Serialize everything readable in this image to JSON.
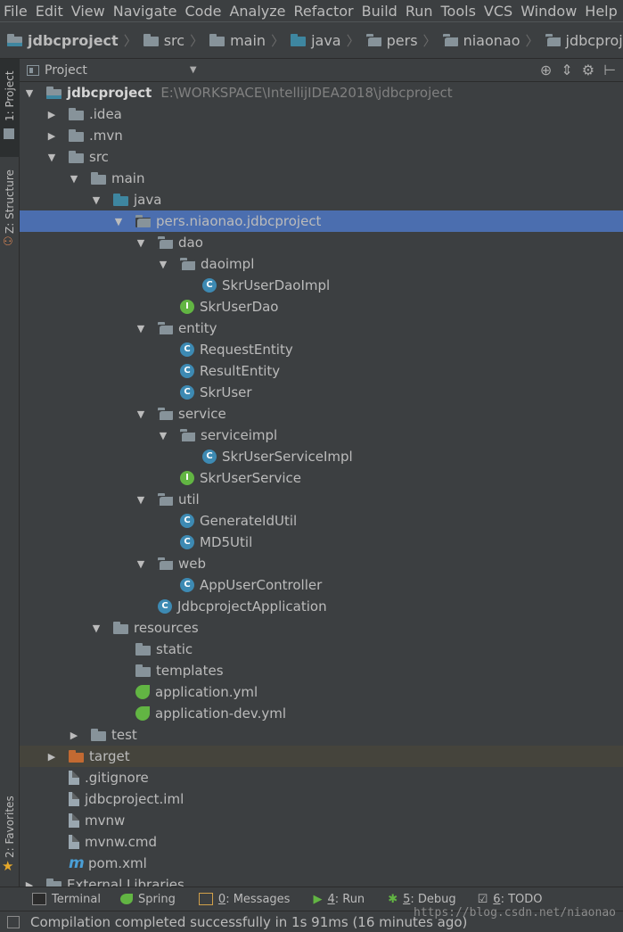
{
  "menubar": [
    "File",
    "Edit",
    "View",
    "Navigate",
    "Code",
    "Analyze",
    "Refactor",
    "Build",
    "Run",
    "Tools",
    "VCS",
    "Window",
    "Help"
  ],
  "breadcrumbs": [
    "jdbcproject",
    "src",
    "main",
    "java",
    "pers",
    "niaonao",
    "jdbcproject"
  ],
  "left_tabs": {
    "project": "1: Project",
    "structure": "Z: Structure",
    "favorites": "2: Favorites"
  },
  "panel": {
    "title": "Project"
  },
  "tree": [
    {
      "label": "jdbcproject",
      "path": "E:\\WORKSPACE\\IntellijIDEA2018\\jdbcproject"
    },
    {
      "label": ".idea"
    },
    {
      "label": ".mvn"
    },
    {
      "label": "src"
    },
    {
      "label": "main"
    },
    {
      "label": "java"
    },
    {
      "label": "pers.niaonao.jdbcproject"
    },
    {
      "label": "dao"
    },
    {
      "label": "daoimpl"
    },
    {
      "label": "SkrUserDaoImpl"
    },
    {
      "label": "SkrUserDao"
    },
    {
      "label": "entity"
    },
    {
      "label": "RequestEntity"
    },
    {
      "label": "ResultEntity"
    },
    {
      "label": "SkrUser"
    },
    {
      "label": "service"
    },
    {
      "label": "serviceimpl"
    },
    {
      "label": "SkrUserServiceImpl"
    },
    {
      "label": "SkrUserService"
    },
    {
      "label": "util"
    },
    {
      "label": "GenerateIdUtil"
    },
    {
      "label": "MD5Util"
    },
    {
      "label": "web"
    },
    {
      "label": "AppUserController"
    },
    {
      "label": "JdbcprojectApplication"
    },
    {
      "label": "resources"
    },
    {
      "label": "static"
    },
    {
      "label": "templates"
    },
    {
      "label": "application.yml"
    },
    {
      "label": "application-dev.yml"
    },
    {
      "label": "test"
    },
    {
      "label": "target"
    },
    {
      "label": ".gitignore"
    },
    {
      "label": "jdbcproject.iml"
    },
    {
      "label": "mvnw"
    },
    {
      "label": "mvnw.cmd"
    },
    {
      "label": "pom.xml"
    },
    {
      "label": "External Libraries"
    }
  ],
  "bottom_tools": [
    {
      "num": "",
      "label": "Terminal"
    },
    {
      "num": "",
      "label": "Spring"
    },
    {
      "num": "0",
      "label": ": Messages"
    },
    {
      "num": "4",
      "label": ": Run"
    },
    {
      "num": "5",
      "label": ": Debug"
    },
    {
      "num": "6",
      "label": ": TODO"
    }
  ],
  "status": "Compilation completed successfully in 1s 91ms (16 minutes ago)",
  "watermark": "https://blog.csdn.net/niaonao"
}
